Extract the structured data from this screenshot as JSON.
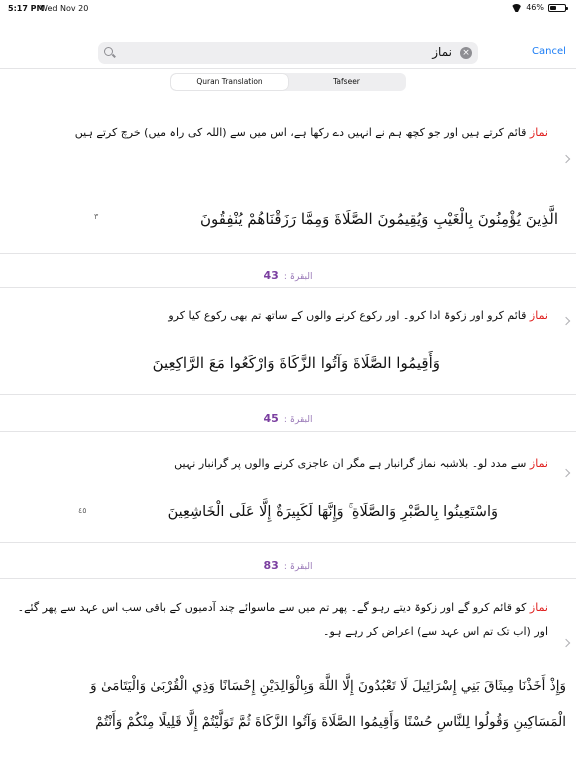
{
  "status_bar": {
    "time": "5:17 PM",
    "date": "Wed Nov 20",
    "battery": "46%",
    "battery_level": 0.46
  },
  "search": {
    "query": "نماز",
    "cancel_label": "Cancel"
  },
  "tabs": [
    {
      "label": "Quran Translation",
      "active": true
    },
    {
      "label": "Tafseer",
      "active": false
    }
  ],
  "results": [
    {
      "translation_highlight": "نماز",
      "translation_rest": " قائم کرتے ہیں اور جو کچھ ہم نے انہیں دے رکھا ہے، اس میں سے (اللہ کی راہ میں) خرچ کرتے ہیں",
      "arabic": "الَّذِينَ يُؤْمِنُونَ بِالْغَيْبِ وَيُقِيمُونَ الصَّلَاةَ وَمِمَّا رَزَقْنَاهُمْ يُنْفِقُونَ",
      "verse_mark": "٣"
    },
    {
      "reference_surah": "البقرۃ :",
      "reference_number": "43",
      "translation_highlight": "نماز",
      "translation_rest": " قائم کرو اور زکوۃ ادا کرو۔ اور رکوع کرنے والوں کے ساتھ تم بھی رکوع کیا کرو",
      "arabic": "وَأَقِيمُوا الصَّلَاةَ وَآتُوا الزَّكَاةَ وَارْكَعُوا مَعَ الرَّاكِعِينَ"
    },
    {
      "reference_surah": "البقرۃ :",
      "reference_number": "45",
      "translation_highlight": "نماز",
      "translation_rest": " سے مدد لو۔ بلاشبہ نماز گرانبار ہے مگر ان عاجزی کرنے والوں پر گرانبار نہیں",
      "arabic": "وَاسْتَعِينُوا بِالصَّبْرِ وَالصَّلَاةِ ۚ وَإِنَّهَا لَكَبِيرَةٌ إِلَّا عَلَى الْخَاشِعِينَ",
      "verse_mark": "٤٥"
    },
    {
      "reference_surah": "البقرۃ :",
      "reference_number": "83",
      "translation_highlight": "نماز",
      "translation_rest": " کو قائم کرو گے اور زکوۃ دیتے رہو گے۔ پھر تم میں سے ماسوائے چند آدمیوں کے باقی سب اس عہد سے پھر گئے۔ اور (اب تک تم اس عہد سے) اعراض کر رہے ہو۔",
      "arabic_line1": "وَإِذْ أَخَذْنَا مِيثَاقَ بَنِي إِسْرَائِيلَ لَا تَعْبُدُونَ إِلَّا اللَّهَ وَبِالْوَالِدَيْنِ إِحْسَانًا وَذِي الْقُرْبَىٰ وَالْيَتَامَىٰ وَ",
      "arabic_line2": "الْمَسَاكِينِ وَقُولُوا لِلنَّاسِ حُسْنًا وَأَقِيمُوا الصَّلَاةَ وَآتُوا الزَّكَاةَ ثُمَّ تَوَلَّيْتُمْ إِلَّا قَلِيلًا مِنْكُمْ وَأَنْتُمْ"
    }
  ]
}
